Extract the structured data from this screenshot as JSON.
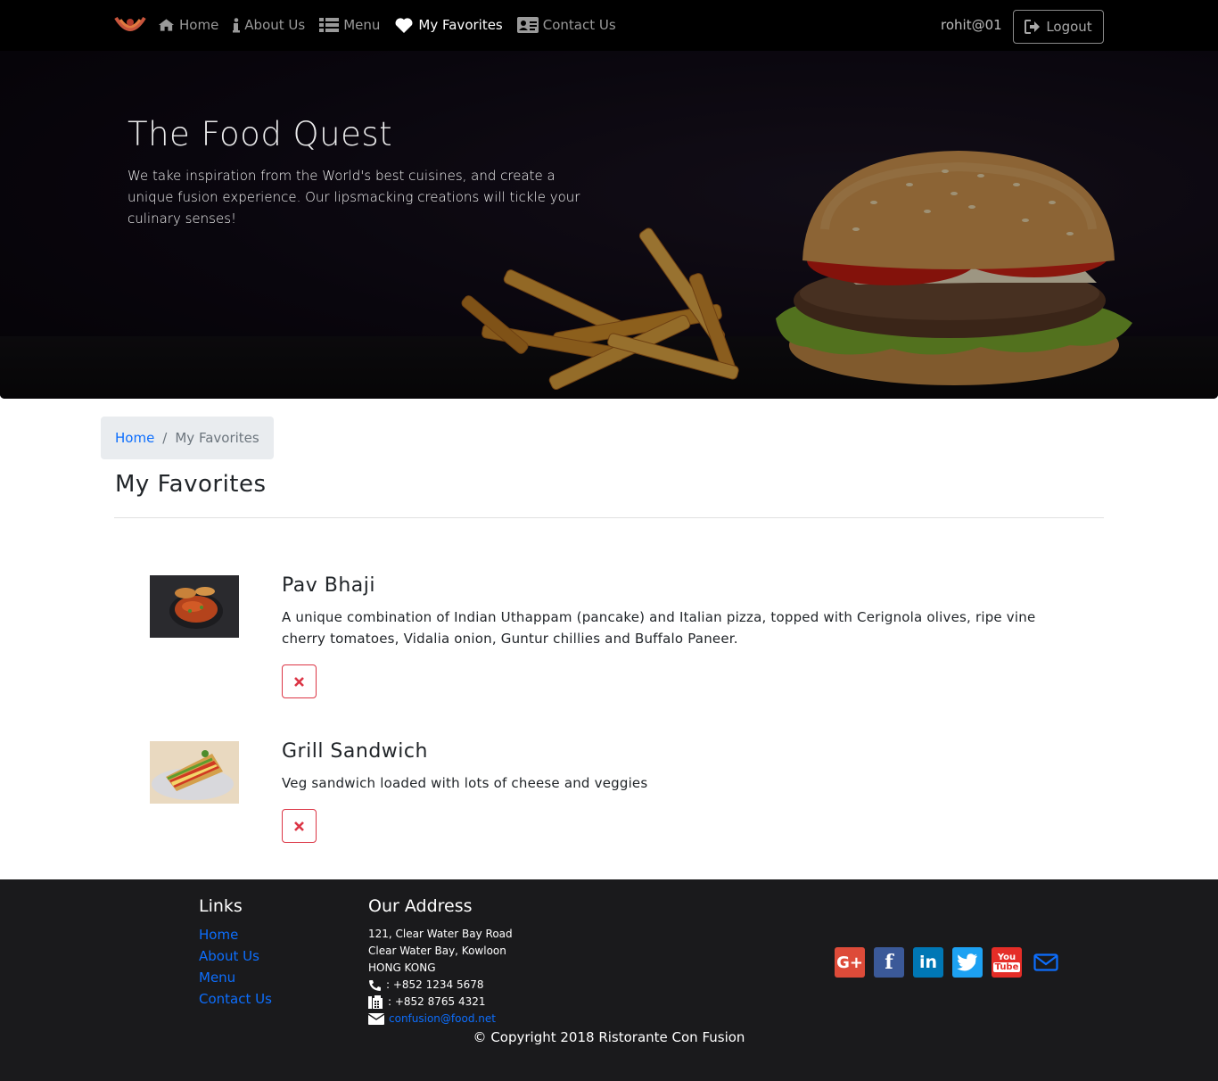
{
  "nav": {
    "items": [
      {
        "label": "Home",
        "icon": "home-icon"
      },
      {
        "label": "About Us",
        "icon": "info-icon"
      },
      {
        "label": "Menu",
        "icon": "list-icon"
      },
      {
        "label": "My Favorites",
        "icon": "heart-icon",
        "active": true
      },
      {
        "label": "Contact Us",
        "icon": "address-card-icon"
      }
    ],
    "username": "rohit@01",
    "logout_label": "Logout"
  },
  "hero": {
    "title": "The Food Quest",
    "text": "We take inspiration from the World's best cuisines, and create a unique fusion experience. Our lipsmacking creations will tickle your culinary senses!"
  },
  "breadcrumb": {
    "home": "Home",
    "separator": "/",
    "current": "My Favorites"
  },
  "page_title": "My Favorites",
  "favorites": [
    {
      "name": "Pav Bhaji",
      "description": "A unique combination of Indian Uthappam (pancake) and Italian pizza, topped with Cerignola olives, ripe vine cherry tomatoes, Vidalia onion, Guntur chillies and Buffalo Paneer.",
      "delete_icon": "times-icon"
    },
    {
      "name": "Grill Sandwich",
      "description": "Veg sandwich loaded with lots of cheese and veggies",
      "delete_icon": "times-icon"
    }
  ],
  "footer": {
    "links_heading": "Links",
    "links": [
      "Home",
      "About Us",
      "Menu",
      "Contact Us"
    ],
    "address_heading": "Our Address",
    "address_lines": [
      "121, Clear Water Bay Road",
      "Clear Water Bay, Kowloon",
      "HONG KONG"
    ],
    "phone": ": +852 1234 5678",
    "fax": ": +852 8765 4321",
    "email": "confusion@food.net",
    "socials": [
      "google-plus-icon",
      "facebook-icon",
      "linkedin-icon",
      "twitter-icon",
      "youtube-icon",
      "envelope-icon"
    ],
    "copyright": "© Copyright 2018 Ristorante Con Fusion"
  },
  "colors": {
    "link": "#0d6efd",
    "danger": "#dc3545",
    "navbar": "#000000",
    "footer": "#1a1a1c"
  }
}
